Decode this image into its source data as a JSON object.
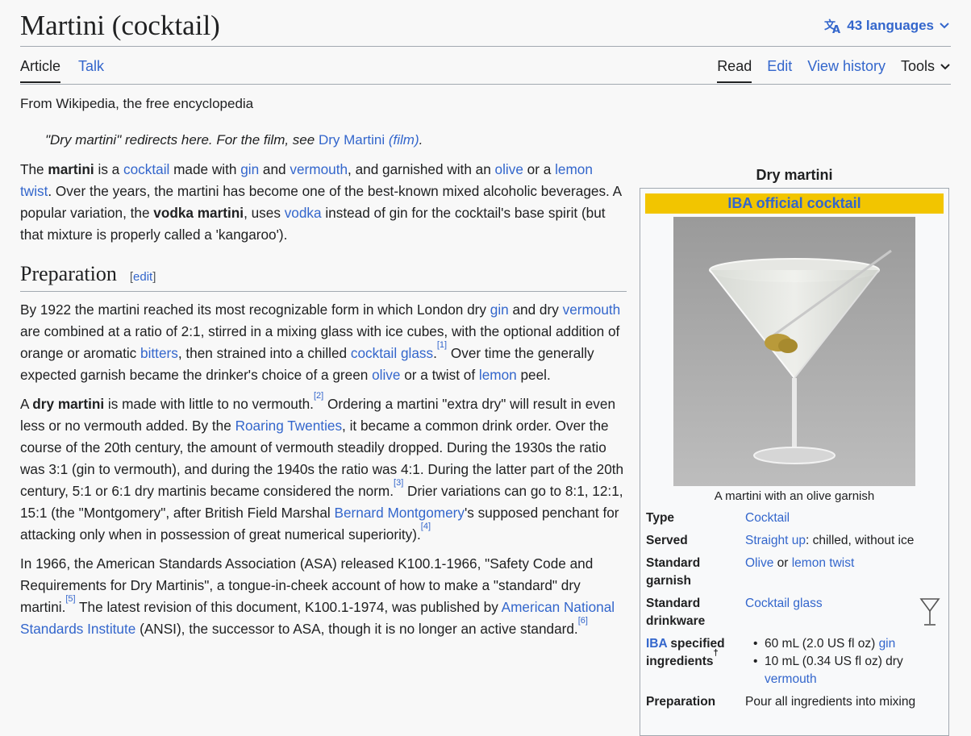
{
  "header": {
    "title": "Martini (cocktail)",
    "languages_label": "43 languages"
  },
  "tabs": {
    "article": "Article",
    "talk": "Talk",
    "read": "Read",
    "edit": "Edit",
    "view_history": "View history",
    "tools": "Tools"
  },
  "tagline": "From Wikipedia, the free encyclopedia",
  "hatnote": {
    "text": "\"Dry martini\" redirects here. For the film, see ",
    "link_main": "Dry Martini",
    "link_film": "(film)",
    "end": "."
  },
  "intro": {
    "t1": "The ",
    "b1": "martini",
    "t2": " is a ",
    "l1": "cocktail",
    "t3": " made with ",
    "l2": "gin",
    "t4": " and ",
    "l3": "vermouth",
    "t5": ", and garnished with an ",
    "l4": "olive",
    "t6": " or a ",
    "l5": "lemon twist",
    "t7": ". Over the years, the martini has become one of the best-known mixed alcoholic beverages. A popular variation, the ",
    "b2": "vodka martini",
    "t8": ", uses ",
    "l6": "vodka",
    "t9": " instead of gin for the cocktail's base spirit (but that mixture is properly called a 'kangaroo')."
  },
  "preparation": {
    "heading": "Preparation",
    "edit_open": "[",
    "edit_label": "edit",
    "edit_close": "]",
    "p1": {
      "t1": "By 1922 the martini reached its most recognizable form in which London dry ",
      "l1": "gin",
      "t2": " and dry ",
      "l2": "vermouth",
      "t3": " are combined at a ratio of 2:1, stirred in a mixing glass with ice cubes, with the optional addition of orange or aromatic ",
      "l3": "bitters",
      "t4": ", then strained into a chilled ",
      "l4": "cocktail glass",
      "t5": ".",
      "ref1": "[1]",
      "t6": " Over time the generally expected garnish became the drinker's choice of a green ",
      "l5": "olive",
      "t7": " or a twist of ",
      "l6": "lemon",
      "t8": " peel."
    },
    "p2": {
      "t1": "A ",
      "b1": "dry martini",
      "t2": " is made with little to no vermouth.",
      "ref2": "[2]",
      "t3": " Ordering a martini \"extra dry\" will result in even less or no vermouth added. By the ",
      "l1": "Roaring Twenties",
      "t4": ", it became a common drink order. Over the course of the 20th century, the amount of vermouth steadily dropped. During the 1930s the ratio was 3:1 (gin to vermouth), and during the 1940s the ratio was 4:1. During the latter part of the 20th century, 5:1 or 6:1 dry martinis became considered the norm.",
      "ref3": "[3]",
      "t5": " Drier variations can go to 8:1, 12:1, 15:1 (the \"Montgomery\", after British Field Marshal ",
      "l2": "Bernard Montgomery",
      "t6": "'s supposed penchant for attacking only when in possession of great numerical superiority).",
      "ref4": "[4]"
    },
    "p3": {
      "t1": "In 1966, the American Standards Association (ASA) released K100.1-1966, \"Safety Code and Requirements for Dry Martinis\", a tongue-in-cheek account of how to make a \"standard\" dry martini.",
      "ref5": "[5]",
      "t2": " The latest revision of this document, K100.1-1974, was published by ",
      "l1": "American National Standards Institute",
      "t3": " (ANSI), the successor to ASA, though it is no longer an active standard.",
      "ref6": "[6]"
    }
  },
  "infobox": {
    "caption": "Dry martini",
    "band": "IBA official cocktail",
    "image_caption": "A martini with an olive garnish",
    "type_label": "Type",
    "type_value": "Cocktail",
    "served_label": "Served",
    "served_link": "Straight up",
    "served_rest": ": chilled, without ice",
    "garnish_label": "Standard garnish",
    "garnish_l1": "Olive",
    "garnish_or": " or ",
    "garnish_l2": "lemon twist",
    "drinkware_label": "Standard drinkware",
    "drinkware_value": "Cocktail glass",
    "ingredients_iba": "IBA",
    "ingredients_label": " specified ingredients",
    "ingredients_dagger": "†",
    "ing1_text": "60 mL (2.0 US fl oz) ",
    "ing1_link": "gin",
    "ing2_text": "10 mL (0.34 US fl oz) dry ",
    "ing2_link": "vermouth",
    "prep_label": "Preparation",
    "prep_value": "Pour all ingredients into mixing"
  },
  "icons": [
    "translate-icon",
    "chevron-down-icon",
    "martini-glass-icon"
  ],
  "colors": {
    "link": "#3366cc",
    "band": "#f2c500",
    "text": "#202122",
    "border": "#a2a9b1"
  }
}
